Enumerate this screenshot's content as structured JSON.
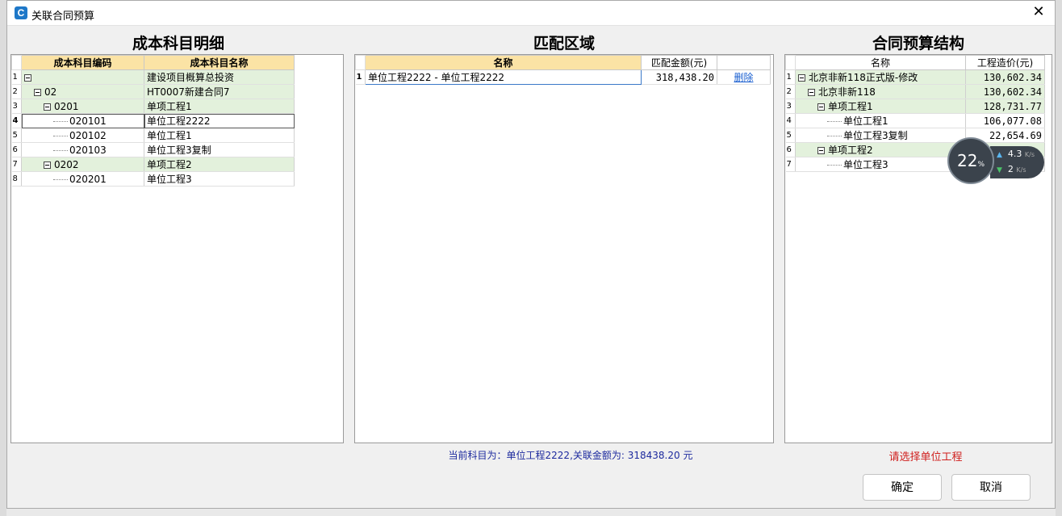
{
  "window": {
    "title": "关联合同预算",
    "close_glyph": "✕",
    "icon_letter": "C"
  },
  "left": {
    "title": "成本科目明细",
    "headers": [
      "成本科目编码",
      "成本科目名称"
    ],
    "rows": [
      {
        "n": "1",
        "code": "",
        "name": "建设项目概算总投资",
        "level": 0,
        "expand": true,
        "green": true
      },
      {
        "n": "2",
        "code": "02",
        "name": "HT0007新建合同7",
        "level": 1,
        "expand": true,
        "green": true
      },
      {
        "n": "3",
        "code": "0201",
        "name": "单项工程1",
        "level": 2,
        "expand": true,
        "green": true
      },
      {
        "n": "4",
        "code": "020101",
        "name": "单位工程2222",
        "level": 3,
        "expand": false,
        "green": false,
        "selected": true
      },
      {
        "n": "5",
        "code": "020102",
        "name": "单位工程1",
        "level": 3,
        "expand": false,
        "green": false
      },
      {
        "n": "6",
        "code": "020103",
        "name": "单位工程3复制",
        "level": 3,
        "expand": false,
        "green": false
      },
      {
        "n": "7",
        "code": "0202",
        "name": "单项工程2",
        "level": 2,
        "expand": true,
        "green": true
      },
      {
        "n": "8",
        "code": "020201",
        "name": "单位工程3",
        "level": 3,
        "expand": false,
        "green": false
      }
    ]
  },
  "middle": {
    "title": "匹配区域",
    "headers": [
      "名称",
      "匹配金额(元)",
      ""
    ],
    "rows": [
      {
        "n": "1",
        "name": "单位工程2222 - 单位工程2222",
        "amount": "318,438.20",
        "action": "删除"
      }
    ],
    "status": "当前科目为：单位工程2222,关联金额为: 318438.20 元"
  },
  "right": {
    "title": "合同预算结构",
    "headers": [
      "名称",
      "工程造价(元)"
    ],
    "rows": [
      {
        "n": "1",
        "name": "北京非新118正式版-修改",
        "amount": "130,602.34",
        "level": 0,
        "expand": true,
        "green": true
      },
      {
        "n": "2",
        "name": "北京非新118",
        "amount": "130,602.34",
        "level": 1,
        "expand": true,
        "green": true
      },
      {
        "n": "3",
        "name": "单项工程1",
        "amount": "128,731.77",
        "level": 2,
        "expand": true,
        "green": true
      },
      {
        "n": "4",
        "name": "单位工程1",
        "amount": "106,077.08",
        "level": 3,
        "expand": false,
        "green": false
      },
      {
        "n": "5",
        "name": "单位工程3复制",
        "amount": "22,654.69",
        "level": 3,
        "expand": false,
        "green": false
      },
      {
        "n": "6",
        "name": "单项工程2",
        "amount": "",
        "level": 2,
        "expand": true,
        "green": true
      },
      {
        "n": "7",
        "name": "单位工程3",
        "amount": "",
        "level": 3,
        "expand": false,
        "green": false
      }
    ],
    "status": "请选择单位工程"
  },
  "buttons": {
    "ok": "确定",
    "cancel": "取消"
  },
  "net_monitor": {
    "percent": "22",
    "percent_unit": "%",
    "up": "4.3",
    "down": "2",
    "unit": "K/s"
  }
}
